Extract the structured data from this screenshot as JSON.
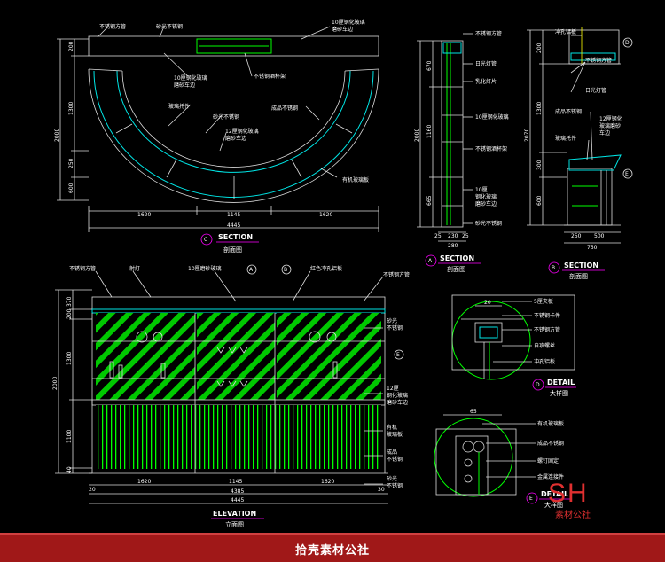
{
  "views": {
    "plan": {
      "code": "C",
      "title": "SECTION",
      "subtitle": "剖面图",
      "labels": [
        "不锈钢方管",
        "砂光不锈钢",
        "10厘钢化玻璃",
        "磨砂车边",
        "10厘钢化玻璃",
        "磨砂车边",
        "不锈钢酒杯架",
        "玻璃托件",
        "砂光不锈钢",
        "成品不锈钢",
        "12厘钢化玻璃",
        "磨砂车边",
        "有机玻璃板"
      ],
      "dims_bottom": [
        "1620",
        "1145",
        "1620"
      ],
      "dim_total": "4445",
      "dims_left": [
        "200",
        "1300",
        "2000",
        "250",
        "600"
      ]
    },
    "section_a": {
      "code": "A",
      "title": "SECTION",
      "subtitle": "剖面图",
      "labels": [
        "不锈钢方管",
        "日光灯管",
        "乳化灯片",
        "10厘钢化玻璃",
        "不锈钢酒杯架",
        "10厘",
        "钢化玻璃",
        "磨砂车边",
        "砂光不锈钢"
      ],
      "dims_left": [
        "670",
        "1160",
        "2000",
        "665"
      ],
      "dims_bottom": [
        "25",
        "230",
        "25"
      ],
      "dim_total": "280"
    },
    "section_b": {
      "code": "B",
      "title": "SECTION",
      "subtitle": "剖面图",
      "labels": [
        "冲孔铝板",
        "不锈钢方管",
        "日光灯管",
        "成品不锈钢",
        "12厘钢化",
        "玻璃磨砂",
        "车边",
        "玻璃托件"
      ],
      "dims_left": [
        "200",
        "1300",
        "2070",
        "300",
        "600"
      ],
      "dims_bottom": [
        "250",
        "500"
      ],
      "dim_total": "750"
    },
    "elevation": {
      "title": "ELEVATION",
      "subtitle": "立面图",
      "labels": [
        "不锈钢方管",
        "射灯",
        "10厘磨砂玻璃",
        "红色冲孔铝板",
        "不锈钢方管",
        "砂光",
        "不锈钢",
        "12厘",
        "钢化玻璃",
        "磨砂车边",
        "有机",
        "玻璃板",
        "成品",
        "不锈钢",
        "砂光",
        "不锈钢"
      ],
      "dims_left": [
        "370",
        "200",
        "1300",
        "2000",
        "1100",
        "40"
      ],
      "dims_bottom": [
        "20",
        "1620",
        "1145",
        "1620",
        "30"
      ],
      "dim_mid": "4385",
      "dim_total": "4445"
    },
    "detail_d": {
      "code": "D",
      "title": "DETAIL",
      "subtitle": "大样图",
      "dim_top": "20",
      "labels": [
        "5厘夹板",
        "不锈钢卡件",
        "不锈钢方管",
        "自攻螺丝",
        "冲孔铝板"
      ]
    },
    "detail_e": {
      "code": "E",
      "title": "DETAIL",
      "subtitle": "大样图",
      "dim_top": "65",
      "labels": [
        "有机玻璃板",
        "成品不锈钢",
        "螺钉固定",
        "金属连接件"
      ]
    },
    "markers": {
      "a": "A",
      "b": "B",
      "d": "D",
      "e": "E"
    }
  },
  "footer": {
    "text": "拾壳素材公社"
  },
  "logo": {
    "mark": "SH",
    "name": "素材公社"
  },
  "colors": {
    "background": "#000000",
    "green": "#00ff00",
    "cyan": "#00e5e5",
    "magenta": "#ff00ff",
    "footer": "#a01818",
    "logo": "#e03030"
  }
}
